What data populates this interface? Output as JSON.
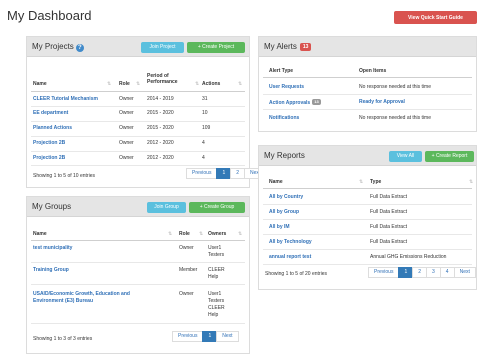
{
  "page": {
    "title": "My Dashboard",
    "quick_guide_label": "View Quick Start Guide"
  },
  "projects": {
    "title": "My Projects",
    "join_label": "Join Project",
    "create_label": "+ Create Project",
    "headers": [
      "Name",
      "Role",
      "Period of Performance",
      "Actions"
    ],
    "rows": [
      [
        "CLEER Tutorial Mechanism",
        "Owner",
        "2014 - 2019",
        "31"
      ],
      [
        "EE department",
        "Owner",
        "2015 - 2020",
        "10"
      ],
      [
        "Planned Actions",
        "Owner",
        "2015 - 2020",
        "109"
      ],
      [
        "Projection 2B",
        "Owner",
        "2012 - 2020",
        "4"
      ],
      [
        "Projection 2B",
        "Owner",
        "2012 - 2020",
        "4"
      ]
    ],
    "info": "Showing 1 to 5 of 10 entries",
    "pager": [
      "Previous",
      "1",
      "2",
      "Next"
    ]
  },
  "groups": {
    "title": "My Groups",
    "join_label": "Join Group",
    "create_label": "+ Create Group",
    "headers": [
      "Name",
      "Role",
      "Owners"
    ],
    "rows": [
      {
        "name": "test municipality",
        "role": "Owner",
        "owners": [
          "User1",
          "Testers"
        ]
      },
      {
        "name": "Training Group",
        "role": "Member",
        "owners": [
          "CLEER",
          "Help"
        ]
      },
      {
        "name": [
          "USAID/Economic Growth, Education and",
          "Environment (E3) Bureau"
        ],
        "role": "Owner",
        "owners": [
          "User1",
          "Testers",
          "CLEER",
          "Help"
        ]
      }
    ],
    "info": "Showing 1 to 3 of 3 entries",
    "pager": [
      "Previous",
      "1",
      "Next"
    ]
  },
  "alerts": {
    "title": "My Alerts",
    "count": "13",
    "headers": [
      "Alert Type",
      "Open Items"
    ],
    "rows": [
      {
        "type": "User Requests",
        "badge": "",
        "item": "No response needed at this time",
        "item_link": false
      },
      {
        "type": "Action Approvals",
        "badge": "13",
        "item": "Ready for Approval",
        "item_link": true
      },
      {
        "type": "Notifications",
        "badge": "",
        "item": "No response needed at this time",
        "item_link": false
      }
    ]
  },
  "reports": {
    "title": "My Reports",
    "view_label": "View All",
    "create_label": "+ Create Report",
    "headers": [
      "Name",
      "Type"
    ],
    "rows": [
      [
        "All by Country",
        "Full Data Extract"
      ],
      [
        "All by Group",
        "Full Data Extract"
      ],
      [
        "All by IM",
        "Full Data Extract"
      ],
      [
        "All by Technology",
        "Full Data Extract"
      ],
      [
        "annual report test",
        "Annual GHG Emissions Reduction"
      ]
    ],
    "info": "Showing 1 to 5 of 20 entries",
    "pager": [
      "Previous",
      "1",
      "2",
      "3",
      "4",
      "Next"
    ]
  },
  "colors": {
    "primary_link": "#3070b7",
    "danger": "#d9534f",
    "info": "#5bc0de",
    "success": "#5cb85c",
    "panel_head": "#e5e5e5"
  }
}
